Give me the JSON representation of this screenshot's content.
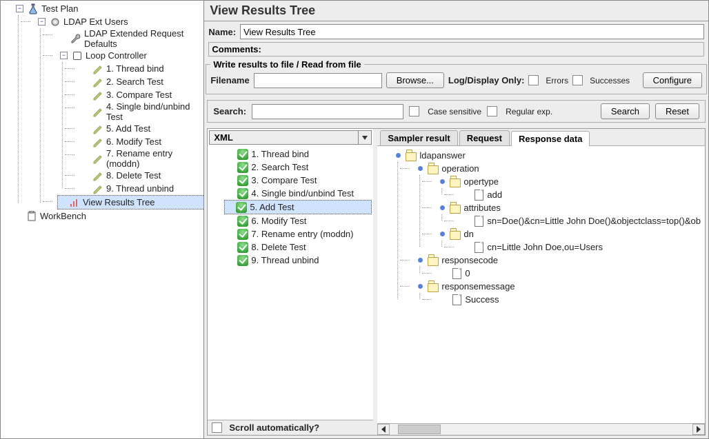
{
  "left_tree": {
    "root": "Test Plan",
    "ldap_users": "LDAP Ext Users",
    "ldap_defaults": "LDAP Extended Request Defaults",
    "loop": "Loop Controller",
    "tests": [
      "1. Thread bind",
      "2. Search Test",
      "3. Compare Test",
      "4. Single bind/unbind Test",
      "5. Add Test",
      "6. Modify Test",
      "7. Rename entry (moddn)",
      "8. Delete Test",
      "9. Thread unbind"
    ],
    "vrt": "View Results Tree",
    "workbench": "WorkBench"
  },
  "panel_title": "View Results Tree",
  "name_label": "Name:",
  "name_value": "View Results Tree",
  "comments_label": "Comments:",
  "file_section": {
    "legend": "Write results to file / Read from file",
    "filename_label": "Filename",
    "filename_value": "",
    "browse": "Browse...",
    "logdisplay": "Log/Display Only:",
    "errors": "Errors",
    "successes": "Successes",
    "configure": "Configure"
  },
  "search_section": {
    "label": "Search:",
    "value": "",
    "case": "Case sensitive",
    "regex": "Regular exp.",
    "search_btn": "Search",
    "reset_btn": "Reset"
  },
  "combo_value": "XML",
  "results": [
    "1. Thread bind",
    "2. Search Test",
    "3. Compare Test",
    "4. Single bind/unbind Test",
    "5. Add Test",
    "6. Modify Test",
    "7. Rename entry (moddn)",
    "8. Delete Test",
    "9. Thread unbind"
  ],
  "results_selected_index": 4,
  "scroll_auto": "Scroll automatically?",
  "tabs": {
    "sampler": "Sampler result",
    "request": "Request",
    "response": "Response data"
  },
  "xml": {
    "root": "ldapanswer",
    "operation": "operation",
    "opertype": "opertype",
    "opertype_val": "add",
    "attributes": "attributes",
    "attributes_val": "sn=Doe()&cn=Little John Doe()&objectclass=top()&ob",
    "dn": "dn",
    "dn_val": "cn=Little John Doe,ou=Users",
    "responsecode": "responsecode",
    "responsecode_val": "0",
    "responsemessage": "responsemessage",
    "responsemessage_val": "Success"
  }
}
